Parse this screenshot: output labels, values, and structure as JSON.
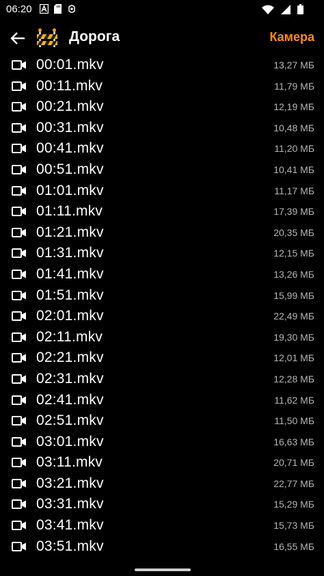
{
  "status_bar": {
    "time": "06:20",
    "icons": [
      "font-icon",
      "sd-card-icon",
      "usb-debug-icon",
      "wifi-icon",
      "mobile-signal-icon",
      "battery-icon"
    ]
  },
  "app_bar": {
    "title": "Дорога",
    "action_label": "Камера",
    "accent_color": "#ff8c1a",
    "icons": [
      "back-arrow-icon",
      "road-barrier-icon"
    ]
  },
  "files": [
    {
      "name": "00:01.mkv",
      "size": "13,27 МБ"
    },
    {
      "name": "00:11.mkv",
      "size": "11,79 МБ"
    },
    {
      "name": "00:21.mkv",
      "size": "12,19 МБ"
    },
    {
      "name": "00:31.mkv",
      "size": "10,48 МБ"
    },
    {
      "name": "00:41.mkv",
      "size": "11,20 МБ"
    },
    {
      "name": "00:51.mkv",
      "size": "10,41 МБ"
    },
    {
      "name": "01:01.mkv",
      "size": "11,17 МБ"
    },
    {
      "name": "01:11.mkv",
      "size": "17,39 МБ"
    },
    {
      "name": "01:21.mkv",
      "size": "20,35 МБ"
    },
    {
      "name": "01:31.mkv",
      "size": "12,15 МБ"
    },
    {
      "name": "01:41.mkv",
      "size": "13,26 МБ"
    },
    {
      "name": "01:51.mkv",
      "size": "15,99 МБ"
    },
    {
      "name": "02:01.mkv",
      "size": "22,49 МБ"
    },
    {
      "name": "02:11.mkv",
      "size": "19,30 МБ"
    },
    {
      "name": "02:21.mkv",
      "size": "12,01 МБ"
    },
    {
      "name": "02:31.mkv",
      "size": "12,28 МБ"
    },
    {
      "name": "02:41.mkv",
      "size": "11,62 МБ"
    },
    {
      "name": "02:51.mkv",
      "size": "11,50 МБ"
    },
    {
      "name": "03:01.mkv",
      "size": "16,63 МБ"
    },
    {
      "name": "03:11.mkv",
      "size": "20,71 МБ"
    },
    {
      "name": "03:21.mkv",
      "size": "22,77 МБ"
    },
    {
      "name": "03:31.mkv",
      "size": "15,29 МБ"
    },
    {
      "name": "03:41.mkv",
      "size": "15,73 МБ"
    },
    {
      "name": "03:51.mkv",
      "size": "16,55 МБ"
    }
  ],
  "file_icon": "video-camera-icon"
}
